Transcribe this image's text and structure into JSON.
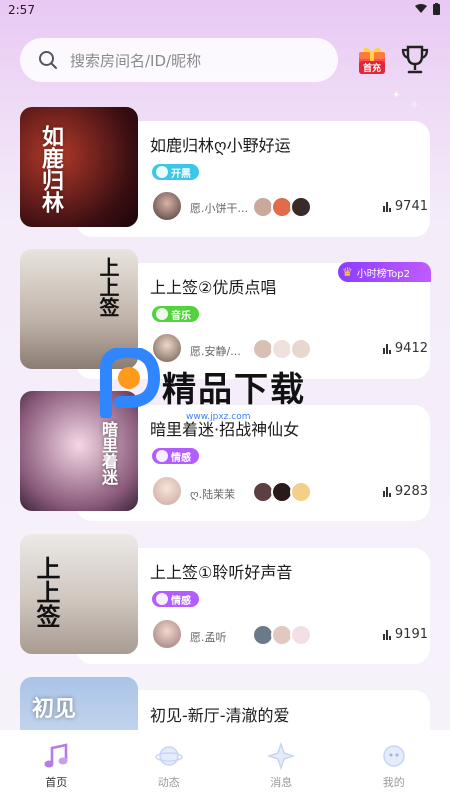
{
  "status": {
    "time": "2:57"
  },
  "search": {
    "placeholder": "搜索房间名/ID/昵称"
  },
  "header": {
    "first_charge_label": "首充"
  },
  "rooms": [
    {
      "title": "如鹿归林ღ小野好运",
      "tag": "开黑",
      "tag_color": "#3cc6e8",
      "host": "愿.小饼干...",
      "heat": "9741",
      "cover_text": "如鹿归林"
    },
    {
      "title": "上上签②优质点唱",
      "tag": "音乐",
      "tag_color": "#52d33b",
      "host": "愿.安静/...",
      "heat": "9412",
      "cover_text": "上上签",
      "rank_badge": "小时榜Top2"
    },
    {
      "title": "暗里着迷·招战神仙女",
      "tag": "情感",
      "tag_color": "#b35cff",
      "host": "ღ.陆茉茉",
      "heat": "9283",
      "cover_text": "暗里着迷"
    },
    {
      "title": "上上签①聆听好声音",
      "tag": "情感",
      "tag_color": "#b35cff",
      "host": "愿.孟听",
      "heat": "9191",
      "cover_text": "上上签"
    },
    {
      "title": "初见-新厅-清澈的爱",
      "cover_text": "初见"
    }
  ],
  "watermark": {
    "text": "精品下载",
    "url": "www.jpxz.com"
  },
  "tabs": [
    {
      "label": "首页",
      "icon": "music-note-icon",
      "active": true
    },
    {
      "label": "动态",
      "icon": "planet-icon",
      "active": false
    },
    {
      "label": "消息",
      "icon": "star-bubble-icon",
      "active": false
    },
    {
      "label": "我的",
      "icon": "profile-planet-icon",
      "active": false
    }
  ]
}
